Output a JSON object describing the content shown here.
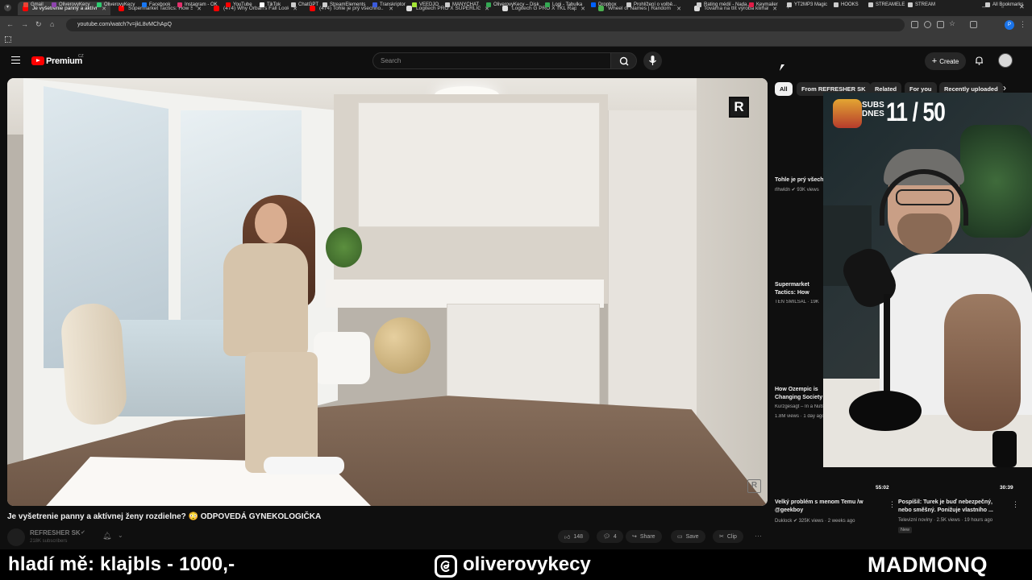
{
  "browser": {
    "tabs": [
      {
        "title": "Je vyšetrenie panny a aktívnej ženy rozdielne? ...",
        "active": true,
        "favicon_color": "#ff0000"
      },
      {
        "title": "Supermarket Tactics: How Stores...",
        "active": false,
        "favicon_color": "#ff0000"
      },
      {
        "title": "(474) Why Orban's Fall Looks Im...",
        "active": false,
        "favicon_color": "#ff0000"
      },
      {
        "title": "(474) Tohle je prý všechno.. věd...",
        "active": false,
        "favicon_color": "#ff0000"
      },
      {
        "title": "Logitech PRO X SUPERLIGHT 2...",
        "active": false,
        "favicon_color": "#dddddd"
      },
      {
        "title": "Logitech G PRO X TKL Rapid, bl...",
        "active": false,
        "favicon_color": "#dddddd"
      },
      {
        "title": "Wheel of Names | Random nam...",
        "active": false,
        "favicon_color": "#4caf50"
      },
      {
        "title": "Továrna na tlít výroba klimatick...",
        "active": false,
        "favicon_color": "#dddddd"
      }
    ],
    "url": "youtube.com/watch?v=jkL8vMChApQ",
    "bookmarks": [
      {
        "label": "Gmail",
        "color": "#ea4335"
      },
      {
        "label": "OliverovyKecy",
        "color": "#8e44ad"
      },
      {
        "label": "OliverovyKecy",
        "color": "#2ecc71"
      },
      {
        "label": "Facebook",
        "color": "#1877f2"
      },
      {
        "label": "Instagram - OK",
        "color": "#e1306c"
      },
      {
        "label": "YouTube",
        "color": "#ff0000"
      },
      {
        "label": "TikTok",
        "color": "#ffffff"
      },
      {
        "label": "ChatGPT",
        "color": "#cccccc"
      },
      {
        "label": "StreamElements",
        "color": "#cccccc"
      },
      {
        "label": "Transkriptor",
        "color": "#3b5bdb"
      },
      {
        "label": "VEEDJO",
        "color": "#a3e635"
      },
      {
        "label": "MANYCHAT",
        "color": "#cccccc"
      },
      {
        "label": "OliverovyKecy – Disk",
        "color": "#34a853"
      },
      {
        "label": "Logi - Tabulka",
        "color": "#34a853"
      },
      {
        "label": "Dropbox",
        "color": "#0061ff"
      },
      {
        "label": "Prohlížení o volbě...",
        "color": "#cccccc"
      },
      {
        "label": "Rating médií - Nada...",
        "color": "#cccccc"
      },
      {
        "label": "Keymailer",
        "color": "#e11d48"
      },
      {
        "label": "YT2MP3 Magic",
        "color": "#cccccc"
      },
      {
        "label": "HOOKS",
        "color": "#cccccc"
      },
      {
        "label": "STREAMELE",
        "color": "#cccccc"
      },
      {
        "label": "STREAM",
        "color": "#cccccc"
      },
      {
        "label": "All Bookmarks",
        "color": "#cccccc"
      }
    ]
  },
  "youtube": {
    "brand": "Premium",
    "region": "CZ",
    "search_placeholder": "Search",
    "create_label": "Create"
  },
  "video": {
    "title": "Je vyšetrenie panny a aktívnej ženy rozdielne? 😳 ODPOVEDÁ GYNEKOLOGIČKA",
    "channel": "REFRESHER SK",
    "subscribers": "218K subscribers",
    "likes": "148",
    "comments": "4",
    "share": "Share",
    "save": "Save",
    "clip": "Clip",
    "watermark": "R"
  },
  "sidebar": {
    "chips": [
      {
        "label": "All",
        "selected": true
      },
      {
        "label": "From REFRESHER SK",
        "selected": false
      },
      {
        "label": "Related",
        "selected": false
      },
      {
        "label": "For you",
        "selected": false
      },
      {
        "label": "Recently uploaded",
        "selected": false
      }
    ],
    "items": [
      {
        "title": "Tohle je prý všechno..",
        "meta": "rlhwldn ✔ 93K views"
      },
      {
        "title": "Supermarket Tactics: How Stores Make You Buy More (TI...",
        "meta": "TEN SMILSAL · 19K"
      },
      {
        "title": "How Ozempic is Changing Society",
        "meta": "Kurzgesagt – In a Nutshell",
        "meta2": "1.8M views · 1 day ago"
      }
    ],
    "bottom": [
      {
        "title": "Velký problém s menom Temu /w @geekboy",
        "meta": "Duklock ✔ 325K views · 2 weeks ago",
        "duration": "55:02"
      },
      {
        "title": "Pospíšil: Turek je buď nebezpečný, nebo směšný. Ponižuje vlastního ...",
        "meta": "Televizní noviny · 2.5K views · 19 hours ago",
        "meta2": "New",
        "duration": "30:39"
      }
    ]
  },
  "webcam": {
    "overlay_label": "SUBS DNES",
    "counter": "11 / 50"
  },
  "streambar": {
    "ticker": "hladí mě: klajbls - 1000,-",
    "instagram_handle": "oliverovykecy",
    "brand": "MADMONQ"
  }
}
